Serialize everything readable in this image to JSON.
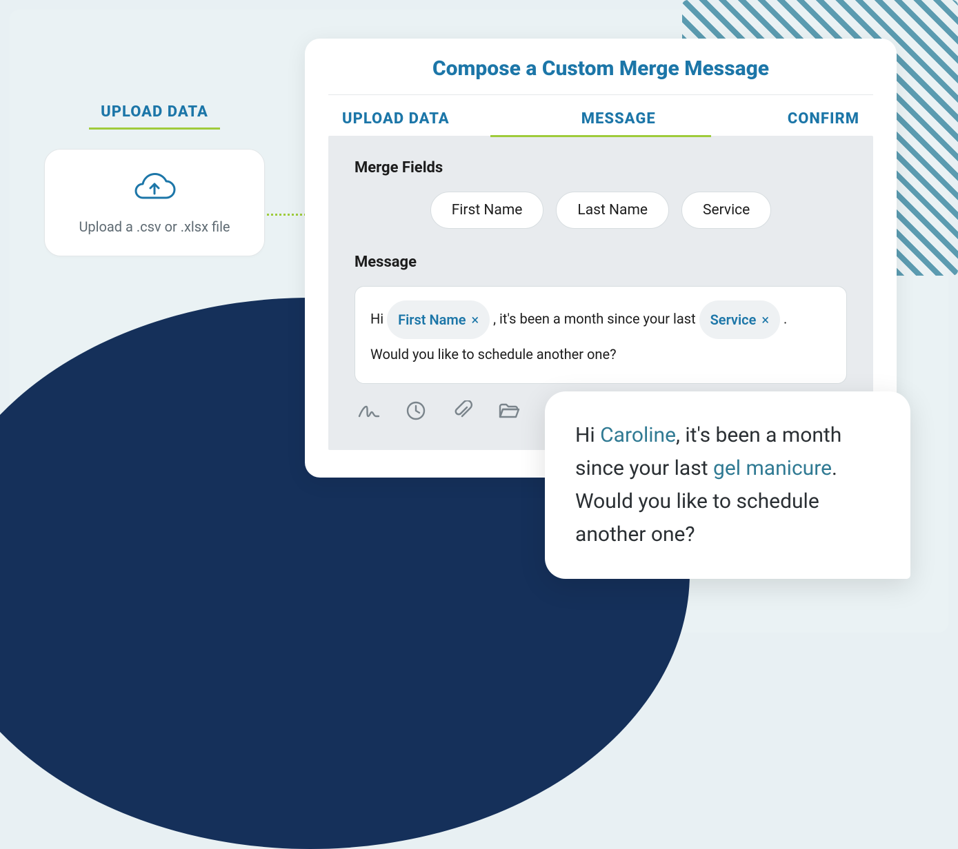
{
  "upload_mini": {
    "tab_label": "UPLOAD DATA",
    "caption": "Upload a .csv or .xlsx file"
  },
  "compose": {
    "title": "Compose a Custom Merge Message",
    "tabs": {
      "upload": "UPLOAD DATA",
      "message": "MESSAGE",
      "confirm": "CONFIRM"
    },
    "merge_fields_label": "Merge Fields",
    "chips": {
      "first_name": "First Name",
      "last_name": "Last Name",
      "service": "Service"
    },
    "message_label": "Message",
    "editor": {
      "t1": "Hi",
      "pill1": "First Name",
      "t2": ", it's been a month since your last",
      "pill2": "Service",
      "t3": ".",
      "t4": "Would you like to schedule another one?"
    }
  },
  "preview": {
    "p1": "Hi ",
    "name": "Caroline",
    "p2": ", it's been a month since your last ",
    "service": "gel manicure",
    "p3": ". Would you like to schedule another one?"
  }
}
